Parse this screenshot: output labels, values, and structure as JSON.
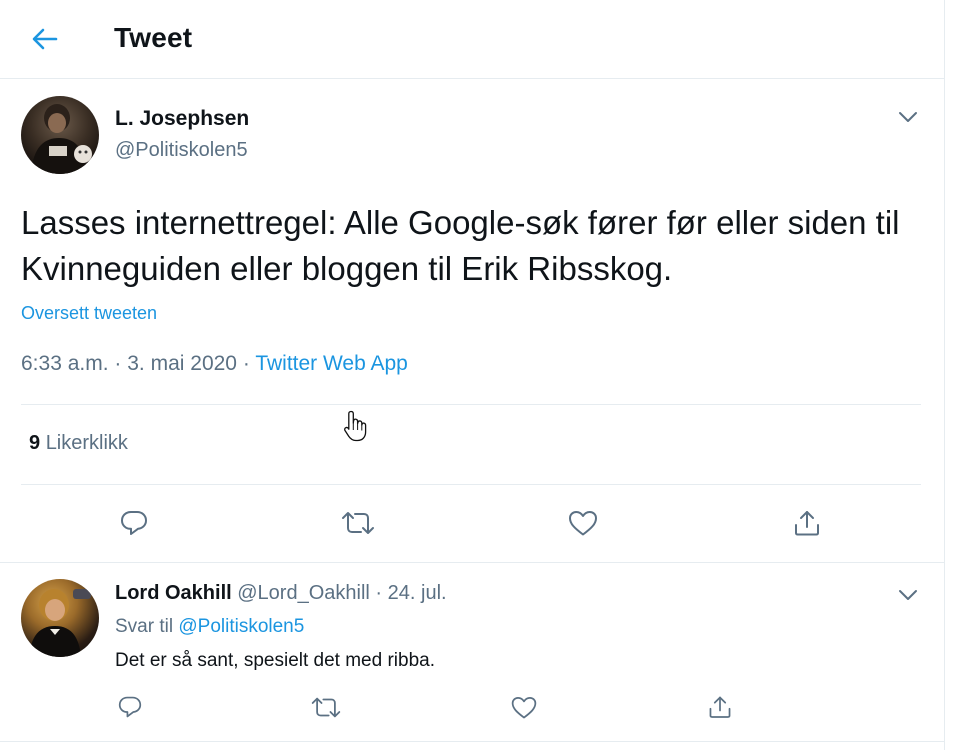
{
  "header": {
    "title": "Tweet",
    "back_icon": "arrow-left-icon"
  },
  "tweet": {
    "author_name": "L. Josephsen",
    "author_handle": "@Politiskolen5",
    "text": "Lasses internettregel: Alle Google-søk fører før eller siden til Kvinneguiden eller bloggen til Erik Ribsskog.",
    "translate_label": "Oversett tweeten",
    "time": "6:33 a.m.",
    "sep1": "·",
    "date": "3. mai 2020",
    "sep2": "·",
    "source": "Twitter Web App",
    "likes_count": "9",
    "likes_label": "Likerklikk"
  },
  "reply": {
    "author_name": "Lord Oakhill",
    "author_handle": "@Lord_Oakhill",
    "sep": "·",
    "date": "24. jul.",
    "reply_to_label": "Svar til",
    "reply_to_handle": "@Politiskolen5",
    "text": "Det er så sant, spesielt det med ribba."
  },
  "colors": {
    "accent": "#1b95e0",
    "secondary_text": "#5b7083",
    "primary_text": "#0f1419",
    "border": "#e6ecf0"
  },
  "icons": {
    "actions": [
      "reply-icon",
      "retweet-icon",
      "like-icon",
      "share-icon"
    ],
    "more": "chevron-down-icon"
  }
}
